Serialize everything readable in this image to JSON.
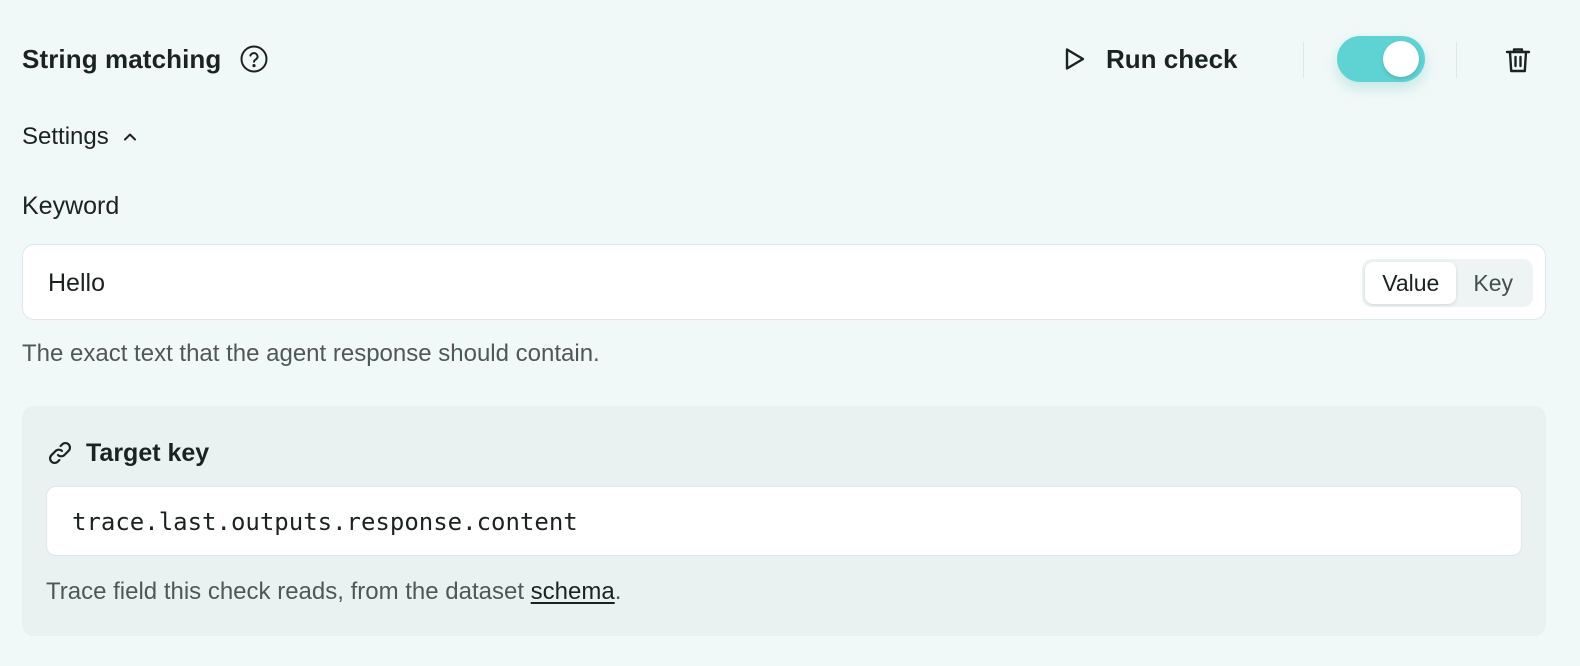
{
  "header": {
    "title": "String matching",
    "help_icon": "question-circle-icon",
    "run_check_label": "Run check",
    "run_check_icon": "play-icon",
    "toggle_enabled": true,
    "delete_icon": "trash-icon"
  },
  "settings": {
    "label": "Settings",
    "expanded": true,
    "chevron_icon": "chevron-up-icon"
  },
  "keyword": {
    "label": "Keyword",
    "value": "Hello",
    "mode_options": [
      "Value",
      "Key"
    ],
    "selected_mode": "Value",
    "hint": "The exact text that the agent response should contain."
  },
  "target_key": {
    "label": "Target key",
    "icon": "link-icon",
    "value": "trace.last.outputs.response.content",
    "hint_prefix": "Trace field this check reads, from the dataset ",
    "hint_link": "schema",
    "hint_suffix": "."
  },
  "colors": {
    "background": "#f1f9f8",
    "toggle_on": "#5fd3d4",
    "panel": "#eaf2f1"
  }
}
